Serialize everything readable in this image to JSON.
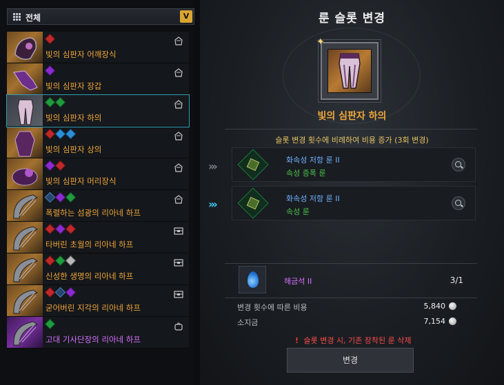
{
  "filter": {
    "label": "전체"
  },
  "items": [
    {
      "name": "빛의 심판자 어깨장식",
      "gems": [
        "red"
      ],
      "thumb": "orange",
      "name_color": "orange",
      "tag_icon": "helmet-icon"
    },
    {
      "name": "빛의 심판자 장갑",
      "gems": [
        "purple"
      ],
      "thumb": "orange",
      "name_color": "orange",
      "tag_icon": "helmet-icon"
    },
    {
      "name": "빛의 심판자 하의",
      "gems": [
        "green",
        "green"
      ],
      "thumb": "selbg",
      "name_color": "orange",
      "tag_icon": "helmet-icon"
    },
    {
      "name": "빛의 심판자 상의",
      "gems": [
        "red",
        "blue",
        "blue"
      ],
      "thumb": "orange",
      "name_color": "orange",
      "tag_icon": "helmet-icon"
    },
    {
      "name": "빛의 심판자 머리장식",
      "gems": [
        "purple",
        "red"
      ],
      "thumb": "orange",
      "name_color": "orange",
      "tag_icon": "helmet-icon"
    },
    {
      "name": "폭렬하는 섬광의 리아네 하프",
      "gems": [
        "navy",
        "purple",
        "green"
      ],
      "thumb": "orange",
      "name_color": "orange",
      "tag_icon": "helmet-icon"
    },
    {
      "name": "타버린 초월의 리아네 하프",
      "gems": [
        "red",
        "purple",
        "red"
      ],
      "thumb": "orange",
      "name_color": "orange",
      "tag_icon": "chest-icon"
    },
    {
      "name": "신성한 생명의 리아네 하프",
      "gems": [
        "red",
        "green",
        "grey"
      ],
      "thumb": "orange",
      "name_color": "orange",
      "tag_icon": "chest-icon"
    },
    {
      "name": "굳어버린 지각의 리아네 하프",
      "gems": [
        "red",
        "navy",
        "purple"
      ],
      "thumb": "orange",
      "name_color": "orange",
      "tag_icon": "chest-icon"
    },
    {
      "name": "고대 기사단장의 리아네 하프",
      "gems": [
        "green"
      ],
      "thumb": "purple",
      "name_color": "pink",
      "tag_icon": "bag-icon"
    }
  ],
  "selected_index": 2,
  "panel": {
    "title": "룬 슬롯 변경",
    "item_name": "빛의 심판자 하의",
    "cost_note": "슬롯 변경 횟수에 비례하여 비용 증가 (3회 변경)"
  },
  "slots": [
    {
      "rune_name": "화속성 저항 룬 II",
      "rune_desc": "속성 증폭 룬",
      "arrow_state": "dim"
    },
    {
      "rune_name": "화속성 저항 룬 II",
      "rune_desc": "속성 룬",
      "arrow_state": "lit"
    }
  ],
  "material": {
    "name": "해금석 II",
    "count": "3/1"
  },
  "costs": [
    {
      "label": "변경 횟수에 따른 비용",
      "value": "5,840"
    },
    {
      "label": "소지금",
      "value": "7,154"
    }
  ],
  "warning": "슬롯 변경 시, 기존 장착된 룬 삭제",
  "button_label": "변경"
}
